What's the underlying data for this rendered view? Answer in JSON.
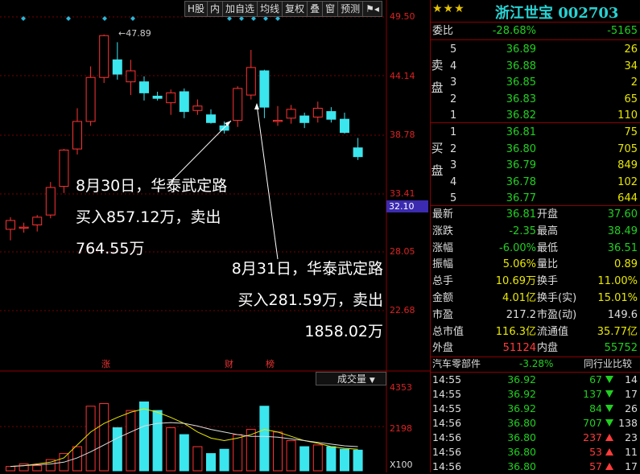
{
  "toolbar": {
    "items": [
      "H股",
      "内",
      "加自选",
      "均线",
      "复权",
      "叠",
      "窗",
      "预测"
    ]
  },
  "chart_data": {
    "type": "candlestick",
    "price_ticks": [
      "49.50",
      "44.14",
      "38.78",
      "33.41",
      "28.05",
      "22.68"
    ],
    "current_price": "32.10",
    "peak_label": "47.89",
    "candles": [
      {
        "o": 30.2,
        "h": 31.3,
        "l": 29.2,
        "c": 31.0
      },
      {
        "o": 30.3,
        "h": 30.8,
        "l": 29.9,
        "c": 30.4
      },
      {
        "o": 30.6,
        "h": 31.5,
        "l": 30.0,
        "c": 31.3
      },
      {
        "o": 31.5,
        "h": 34.5,
        "l": 31.2,
        "c": 34.0
      },
      {
        "o": 34.1,
        "h": 37.5,
        "l": 33.5,
        "c": 37.4
      },
      {
        "o": 37.5,
        "h": 41.2,
        "l": 37.0,
        "c": 40.0
      },
      {
        "o": 40.0,
        "h": 45.0,
        "l": 39.6,
        "c": 44.0
      },
      {
        "o": 44.0,
        "h": 47.9,
        "l": 43.5,
        "c": 47.8
      },
      {
        "o": 45.6,
        "h": 47.2,
        "l": 43.8,
        "c": 44.3
      },
      {
        "o": 43.6,
        "h": 45.6,
        "l": 42.4,
        "c": 44.6
      },
      {
        "o": 43.6,
        "h": 44.1,
        "l": 41.9,
        "c": 42.6
      },
      {
        "o": 42.3,
        "h": 42.7,
        "l": 41.9,
        "c": 42.1
      },
      {
        "o": 41.7,
        "h": 42.9,
        "l": 40.6,
        "c": 42.6
      },
      {
        "o": 42.7,
        "h": 43.0,
        "l": 40.3,
        "c": 40.9
      },
      {
        "o": 41.0,
        "h": 42.0,
        "l": 40.6,
        "c": 41.4
      },
      {
        "o": 40.6,
        "h": 41.1,
        "l": 39.8,
        "c": 39.9
      },
      {
        "o": 39.6,
        "h": 40.0,
        "l": 38.9,
        "c": 39.2
      },
      {
        "o": 40.1,
        "h": 43.2,
        "l": 39.5,
        "c": 43.0
      },
      {
        "o": 42.4,
        "h": 46.5,
        "l": 42.0,
        "c": 44.9
      },
      {
        "o": 44.6,
        "h": 44.7,
        "l": 40.3,
        "c": 41.3
      },
      {
        "o": 40.0,
        "h": 41.4,
        "l": 39.6,
        "c": 40.1
      },
      {
        "o": 40.3,
        "h": 41.5,
        "l": 39.8,
        "c": 41.1
      },
      {
        "o": 40.5,
        "h": 40.8,
        "l": 39.4,
        "c": 39.9
      },
      {
        "o": 40.4,
        "h": 41.8,
        "l": 39.9,
        "c": 41.2
      },
      {
        "o": 40.9,
        "h": 41.3,
        "l": 39.9,
        "c": 40.2
      },
      {
        "o": 40.2,
        "h": 40.8,
        "l": 38.9,
        "c": 39.0
      },
      {
        "o": 37.6,
        "h": 38.5,
        "l": 36.5,
        "c": 36.8
      }
    ],
    "volume_ticks": [
      "4353",
      "2198"
    ],
    "volume_unit": "X100",
    "volume_selector": "成交量",
    "volumes": [
      0.05,
      0.08,
      0.06,
      0.13,
      0.2,
      0.28,
      0.75,
      0.78,
      0.5,
      0.7,
      0.8,
      0.7,
      0.5,
      0.42,
      0.28,
      0.2,
      0.25,
      0.42,
      0.48,
      0.75,
      0.45,
      0.35,
      0.28,
      0.3,
      0.28,
      0.25,
      0.24
    ],
    "events": [
      "涨",
      "财",
      "榜"
    ]
  },
  "annotations": {
    "a1": {
      "line1": "8月30日，华泰武定路",
      "line2": "买入857.12万，卖出",
      "line3": "764.55万"
    },
    "a2": {
      "line1": "8月31日，华泰武定路",
      "line2": "买入281.59万，卖出",
      "line3": "1858.02万"
    }
  },
  "panel": {
    "stars": "★★★",
    "name": "浙江世宝 002703",
    "weibi": {
      "label": "委比",
      "pct": "-28.68%",
      "diff": "-5165"
    },
    "sell_label": [
      "卖",
      "盘"
    ],
    "buy_label": [
      "买",
      "盘"
    ],
    "sell": [
      {
        "lvl": "5",
        "price": "36.89",
        "vol": "26"
      },
      {
        "lvl": "4",
        "price": "36.88",
        "vol": "34"
      },
      {
        "lvl": "3",
        "price": "36.85",
        "vol": "2"
      },
      {
        "lvl": "2",
        "price": "36.83",
        "vol": "65"
      },
      {
        "lvl": "1",
        "price": "36.82",
        "vol": "110"
      }
    ],
    "buy": [
      {
        "lvl": "1",
        "price": "36.81",
        "vol": "75"
      },
      {
        "lvl": "2",
        "price": "36.80",
        "vol": "705"
      },
      {
        "lvl": "3",
        "price": "36.79",
        "vol": "849"
      },
      {
        "lvl": "4",
        "price": "36.78",
        "vol": "102"
      },
      {
        "lvl": "5",
        "price": "36.77",
        "vol": "644"
      }
    ],
    "stats": [
      {
        "l1": "最新",
        "v1": "36.81",
        "c1": "green",
        "l2": "开盘",
        "v2": "37.60",
        "c2": "green"
      },
      {
        "l1": "涨跌",
        "v1": "-2.35",
        "c1": "green",
        "l2": "最高",
        "v2": "38.49",
        "c2": "green"
      },
      {
        "l1": "涨幅",
        "v1": "-6.00%",
        "c1": "green",
        "l2": "最低",
        "v2": "36.51",
        "c2": "green"
      },
      {
        "l1": "振幅",
        "v1": "5.06%",
        "c1": "yellow",
        "l2": "量比",
        "v2": "0.89",
        "c2": "yellow"
      },
      {
        "l1": "总手",
        "v1": "10.69万",
        "c1": "yellow",
        "l2": "换手",
        "v2": "11.00%",
        "c2": "yellow"
      },
      {
        "l1": "金额",
        "v1": "4.01亿",
        "c1": "yellow",
        "l2": "换手(实)",
        "v2": "15.01%",
        "c2": "yellow"
      },
      {
        "l1": "市盈",
        "v1": "217.2",
        "c1": "white",
        "l2": "市盈(动)",
        "v2": "149.6",
        "c2": "white"
      },
      {
        "l1": "总市值",
        "v1": "116.3亿",
        "c1": "yellow",
        "l2": "流通值",
        "v2": "35.77亿",
        "c2": "yellow"
      },
      {
        "l1": "外盘",
        "v1": "51124",
        "c1": "red",
        "l2": "内盘",
        "v2": "55752",
        "c2": "green"
      }
    ],
    "sector": {
      "name": "汽车零部件",
      "pct": "-3.28%",
      "compare": "同行业比较"
    },
    "ticks": [
      {
        "t": "14:55",
        "p": "36.92",
        "v": "67",
        "d": "dn",
        "n": "14"
      },
      {
        "t": "14:55",
        "p": "36.92",
        "v": "137",
        "d": "dn",
        "n": "17"
      },
      {
        "t": "14:55",
        "p": "36.92",
        "v": "84",
        "d": "dn",
        "n": "26"
      },
      {
        "t": "14:56",
        "p": "36.80",
        "v": "707",
        "d": "dn",
        "n": "138"
      },
      {
        "t": "14:56",
        "p": "36.80",
        "v": "237",
        "d": "up",
        "n": "23"
      },
      {
        "t": "14:56",
        "p": "36.80",
        "v": "53",
        "d": "up",
        "n": "11"
      },
      {
        "t": "14:56",
        "p": "36.80",
        "v": "57",
        "d": "up",
        "n": "17"
      }
    ]
  }
}
